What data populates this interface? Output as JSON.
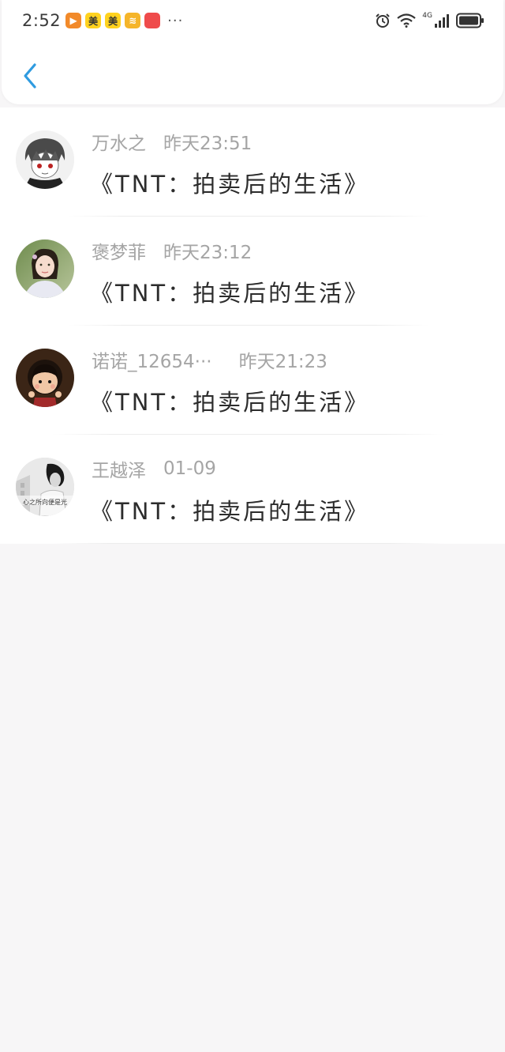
{
  "status_bar": {
    "time": "2:52",
    "apps": [
      {
        "icon": "video-app-icon",
        "label": "▶",
        "color": "#f28a2a"
      },
      {
        "icon": "meituan-app-icon",
        "label": "美",
        "color": "#ffd21f"
      },
      {
        "icon": "meituan-app-icon",
        "label": "美",
        "color": "#ffd21f"
      },
      {
        "icon": "reader-app-icon",
        "label": "≋",
        "color": "#f5b52a"
      },
      {
        "icon": "huawei-app-icon",
        "label": "",
        "color": "#ef4b4b"
      }
    ],
    "more": "···",
    "network_label": "4G"
  },
  "nav": {
    "back_icon": "chevron-left-icon",
    "accent_color": "#2f9be0"
  },
  "items": [
    {
      "name": "万水之",
      "time": "昨天23:51",
      "title": "《TNT：拍卖后的生活》",
      "avatar": "anime-boy-avatar"
    },
    {
      "name": "褒梦菲",
      "time": "昨天23:12",
      "title": "《TNT：拍卖后的生活》",
      "avatar": "girl-photo-avatar"
    },
    {
      "name": "诺诺_12654···",
      "time": "昨天21:23",
      "title": "《TNT：拍卖后的生活》",
      "avatar": "chibi-child-avatar"
    },
    {
      "name": "王越泽",
      "time": "01-09",
      "title": "《TNT：拍卖后的生活》",
      "avatar": "text-sketch-avatar",
      "avatar_text": "心之所向便是光"
    }
  ]
}
